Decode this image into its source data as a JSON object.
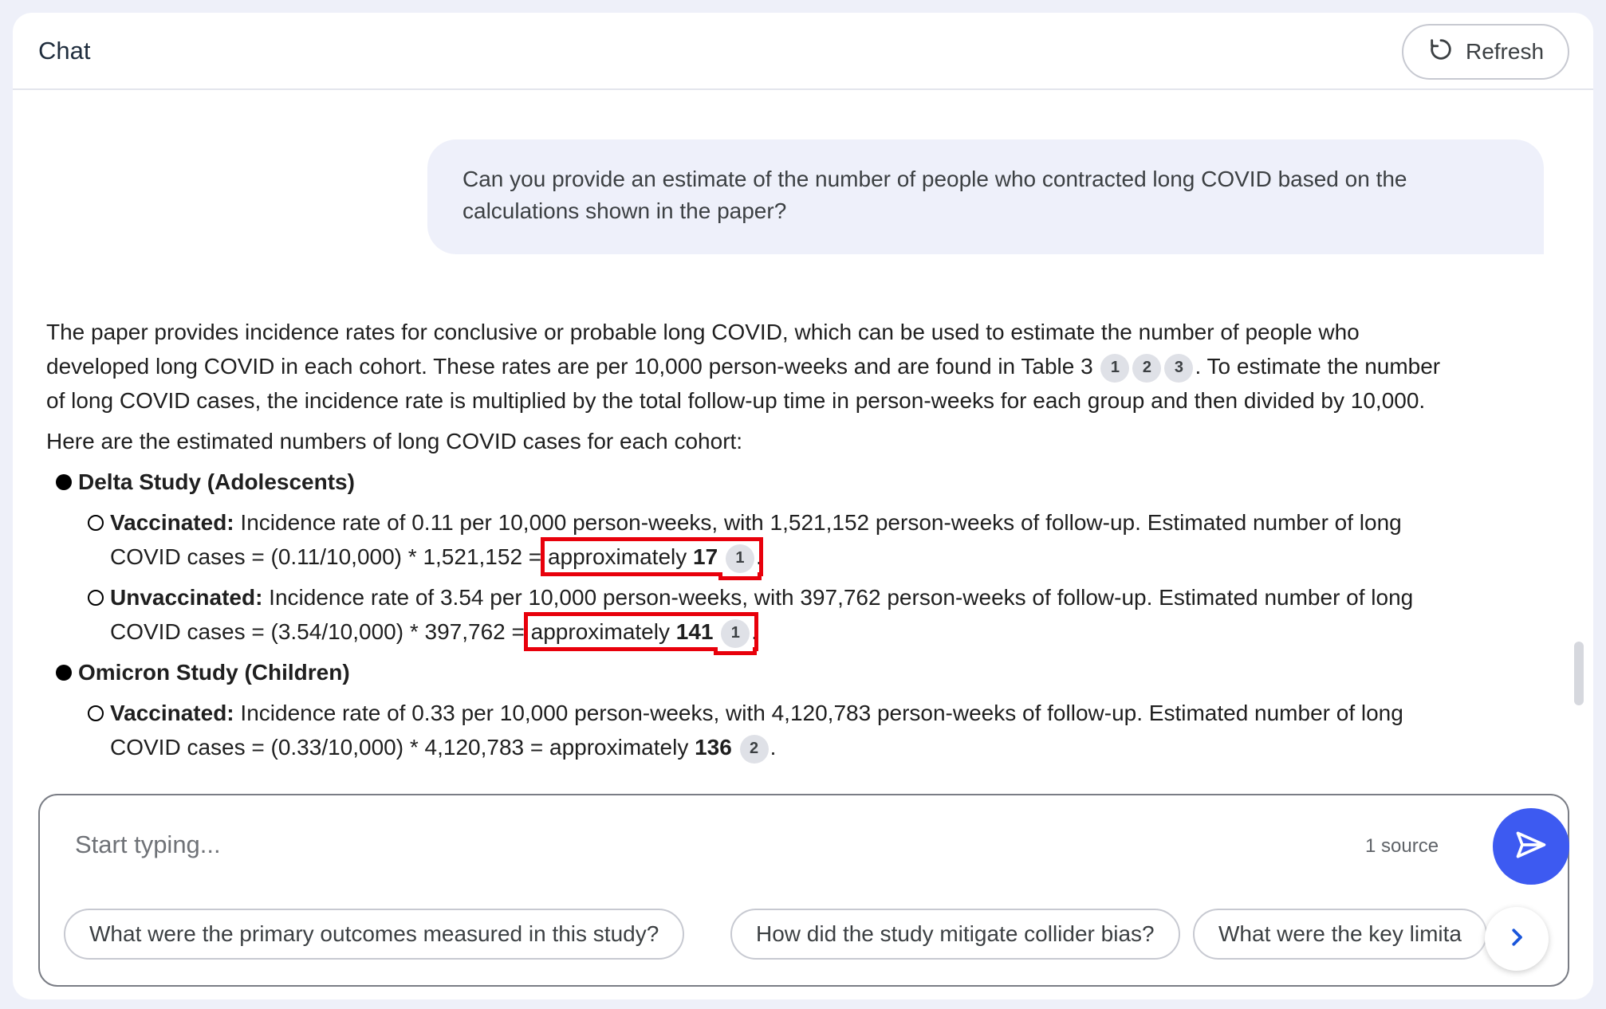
{
  "header": {
    "title": "Chat",
    "refresh_label": "Refresh"
  },
  "chat": {
    "user_message": "Can you provide an estimate of the number of people who contracted long COVID based on the calculations shown in the paper?",
    "answer": {
      "intro_1": "The paper provides incidence rates for conclusive or probable long COVID, which can be used to estimate the number of people who developed long COVID in each cohort. These rates are per 10,000 person-weeks and are found in Table 3",
      "intro_citations": [
        "1",
        "2",
        "3"
      ],
      "intro_2": ". To estimate the number of long COVID cases, the incidence rate is multiplied by the total follow-up time in person-weeks for each group and then divided by 10,000.",
      "lead": "Here are the estimated numbers of long COVID cases for each cohort:",
      "studies": [
        {
          "title": "Delta Study (Adolescents)",
          "groups": [
            {
              "label": "Vaccinated:",
              "text": " Incidence rate of 0.11 per 10,000 person-weeks, with 1,521,152 person-weeks of follow-up. Estimated number of long COVID cases = (0.11/10,000) * 1,521,152 = ",
              "approx": "approximately ",
              "value": "17",
              "citation": "1",
              "end": "."
            },
            {
              "label": "Unvaccinated:",
              "text": " Incidence rate of 3.54 per 10,000 person-weeks, with 397,762 person-weeks of follow-up. Estimated number of long COVID cases = (3.54/10,000) * 397,762 = ",
              "approx": "approximately ",
              "value": "141",
              "citation": "1",
              "end": "."
            }
          ]
        },
        {
          "title": "Omicron Study (Children)",
          "groups": [
            {
              "label": "Vaccinated:",
              "text": " Incidence rate of 0.33 per 10,000 person-weeks, with 4,120,783 person-weeks of follow-up. Estimated number of long COVID cases = (0.33/10,000) * 4,120,783 = ",
              "approx": "approximately ",
              "value": "136",
              "citation": "2",
              "end": "."
            }
          ]
        }
      ]
    }
  },
  "composer": {
    "placeholder": "Start typing...",
    "source_count": "1 source"
  },
  "suggestions": [
    "What were the primary outcomes measured in this study?",
    "How did the study mitigate collider bias?",
    "What were the key limita"
  ],
  "colors": {
    "accent": "#3d5af1",
    "highlight": "#e8000b",
    "user_bubble": "#eef0fa"
  },
  "icons": {
    "refresh": "refresh-icon",
    "send": "send-icon",
    "next": "chevron-right-icon"
  }
}
